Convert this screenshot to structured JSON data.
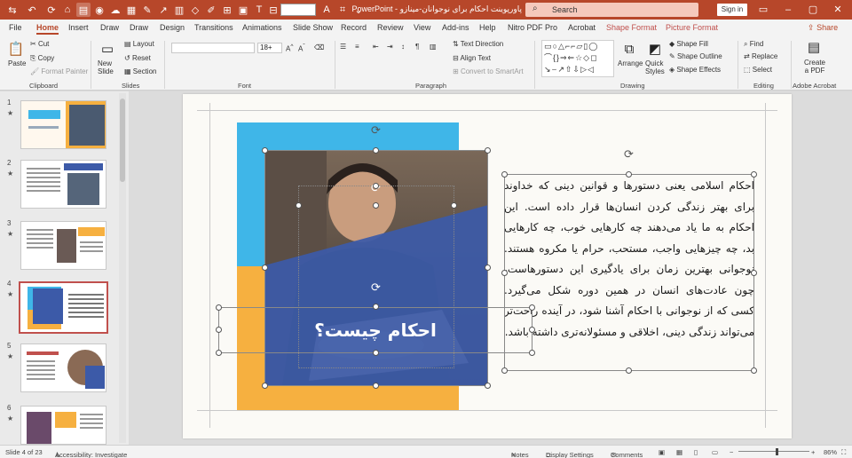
{
  "app": {
    "name": "PowerPoint",
    "doc_title": "پاورپوینت احکام برای نوجوانان-مینازو",
    "search_placeholder": "Search",
    "signin": "Sign in"
  },
  "tabs": [
    "File",
    "Home",
    "Insert",
    "Draw",
    "Draw",
    "Design",
    "Transitions",
    "Animations",
    "Slide Show",
    "Record",
    "Review",
    "View",
    "Add-ins",
    "Help",
    "Nitro PDF Pro",
    "Acrobat",
    "Shape Format",
    "Picture Format"
  ],
  "active_tab": "Home",
  "share_label": "Share",
  "ribbon": {
    "clipboard": {
      "paste": "Paste",
      "cut": "Cut",
      "copy": "Copy",
      "format_painter": "Format Painter",
      "label": "Clipboard"
    },
    "slides": {
      "new_slide": "New Slide",
      "layout": "Layout",
      "reset": "Reset",
      "section": "Section",
      "label": "Slides"
    },
    "font": {
      "size": "18+",
      "label": "Font"
    },
    "paragraph": {
      "text_direction": "Text Direction",
      "align_text": "Align Text",
      "convert_smartart": "Convert to SmartArt",
      "label": "Paragraph"
    },
    "drawing": {
      "arrange": "Arrange",
      "quick_styles": "Quick Styles",
      "shape_fill": "Shape Fill",
      "shape_outline": "Shape Outline",
      "shape_effects": "Shape Effects",
      "label": "Drawing"
    },
    "editing": {
      "find": "Find",
      "replace": "Replace",
      "select": "Select",
      "label": "Editing"
    },
    "acrobat": {
      "create_pdf": "Create a PDF",
      "label": "Adobe Acrobat"
    }
  },
  "thumbnails": [
    {
      "num": "1",
      "star": "★"
    },
    {
      "num": "2",
      "star": "★"
    },
    {
      "num": "3",
      "star": "★"
    },
    {
      "num": "4",
      "star": "★"
    },
    {
      "num": "5",
      "star": "★"
    },
    {
      "num": "6",
      "star": "★"
    }
  ],
  "selected_slide": "4",
  "slide": {
    "title": "احکام چیست؟",
    "body": "احکام اسلامی یعنی دستورها و قوانین دینی که خداوند برای بهتر زندگی کردن انسان‌ها قرار داده است. این احکام به ما یاد می‌دهند چه کارهایی خوب، چه کارهایی بد، چه چیزهایی واجب، مستحب، حرام یا مکروه هستند. نوجوانی بهترین زمان برای یادگیری این دستورهاست، چون عادت‌های انسان در همین دوره شکل می‌گیرد. کسی که از نوجوانی با احکام آشنا شود، در آینده راحت‌تر می‌تواند زندگی دینی، اخلاقی و مسئولانه‌تری داشته باشد.",
    "colors": {
      "cyan": "#3fb6e8",
      "orange": "#f6b040",
      "overlay": "#3c5aa8"
    }
  },
  "status": {
    "slide_info": "Slide 4 of 23",
    "accessibility": "Accessibility: Investigate",
    "notes": "Notes",
    "display_settings": "Display Settings",
    "comments": "Comments",
    "zoom": "86%"
  },
  "colors": {
    "accent": "#b7472a"
  }
}
